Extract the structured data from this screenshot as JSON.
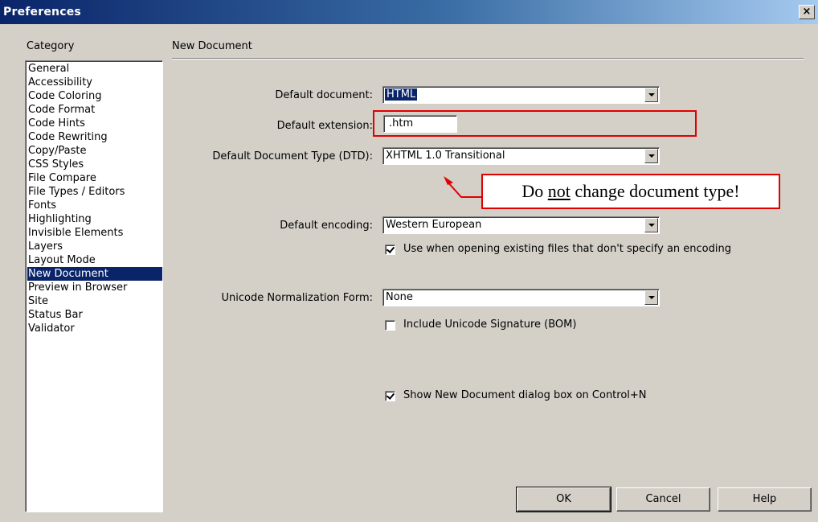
{
  "window": {
    "title": "Preferences",
    "close_label": "×"
  },
  "category": {
    "header": "Category",
    "items": [
      "General",
      "Accessibility",
      "Code Coloring",
      "Code Format",
      "Code Hints",
      "Code Rewriting",
      "Copy/Paste",
      "CSS Styles",
      "File Compare",
      "File Types / Editors",
      "Fonts",
      "Highlighting",
      "Invisible Elements",
      "Layers",
      "Layout Mode",
      "New Document",
      "Preview in Browser",
      "Site",
      "Status Bar",
      "Validator"
    ],
    "selected": "New Document"
  },
  "panel": {
    "title": "New Document",
    "default_document": {
      "label": "Default document:",
      "value": "HTML"
    },
    "default_extension": {
      "label": "Default extension:",
      "value": ".htm"
    },
    "doc_type": {
      "label": "Default Document Type (DTD):",
      "value": "XHTML 1.0 Transitional"
    },
    "encoding": {
      "label": "Default encoding:",
      "value": "Western European"
    },
    "use_encoding": {
      "label": "Use when opening existing files that don't specify an encoding",
      "checked": true
    },
    "unicode_form": {
      "label": "Unicode Normalization Form:",
      "value": "None"
    },
    "include_bom": {
      "label": "Include Unicode Signature (BOM)",
      "checked": false
    },
    "show_dialog": {
      "label": "Show New Document dialog box on Control+N",
      "checked": true
    }
  },
  "callout": {
    "pre": "Do ",
    "emph": "not",
    "post": " change document type!"
  },
  "buttons": {
    "ok": "OK",
    "cancel": "Cancel",
    "help": "Help"
  },
  "colors": {
    "annotation_red": "#e00000",
    "selection": "#0a246a",
    "dialog_bg": "#d4d0c8"
  }
}
